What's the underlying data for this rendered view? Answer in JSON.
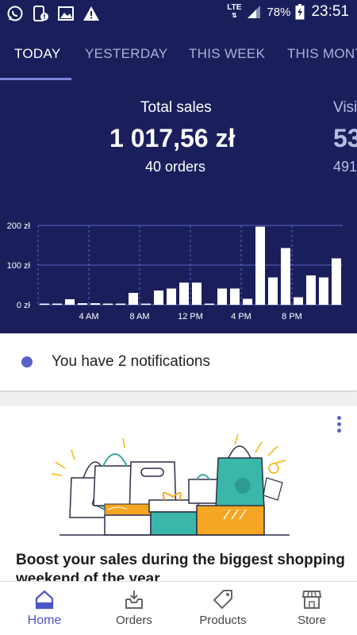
{
  "status_bar": {
    "network": "LTE",
    "battery_percent": "78%",
    "time": "23:51",
    "left_icons": [
      "whatsapp-icon",
      "phone-alert-icon",
      "gallery-icon",
      "warning-icon"
    ]
  },
  "tabs": [
    {
      "label": "TODAY",
      "active": true
    },
    {
      "label": "YESTERDAY",
      "active": false
    },
    {
      "label": "THIS WEEK",
      "active": false
    },
    {
      "label": "THIS MONT",
      "active": false
    }
  ],
  "stats": {
    "sales": {
      "title": "Total sales",
      "value": "1 017,56 zł",
      "sub": "40 orders"
    },
    "visitors": {
      "title": "Visi",
      "value": "53",
      "sub": "491"
    }
  },
  "chart_data": {
    "type": "bar",
    "y_tick_labels": [
      "200 zł",
      "100 zł",
      "0 zł"
    ],
    "y_ticks": [
      200,
      100,
      0
    ],
    "ylim": [
      0,
      200
    ],
    "x_tick_labels": [
      "4 AM",
      "8 AM",
      "12 PM",
      "4 PM",
      "8 PM"
    ],
    "x_ticks_at_hour": [
      4,
      8,
      12,
      16,
      20
    ],
    "hours": [
      0,
      1,
      2,
      3,
      4,
      5,
      6,
      7,
      8,
      9,
      10,
      11,
      12,
      13,
      14,
      15,
      16,
      17,
      18,
      19,
      20,
      21,
      22,
      23
    ],
    "values": [
      3,
      3,
      14,
      4,
      4,
      3,
      3,
      30,
      3,
      36,
      41,
      56,
      56,
      3,
      41,
      41,
      15,
      197,
      69,
      143,
      19,
      74,
      69,
      117
    ],
    "bar_color": "#ffffff",
    "grid": true
  },
  "notification": {
    "text": "You have 2 notifications"
  },
  "promo_card": {
    "title": "Boost your sales during the biggest shopping weekend of the year",
    "menu_icon": "more-vertical-icon"
  },
  "bottom_nav": [
    {
      "label": "Home",
      "icon": "home-icon",
      "active": true
    },
    {
      "label": "Orders",
      "icon": "orders-inbox-icon",
      "active": false
    },
    {
      "label": "Products",
      "icon": "tag-icon",
      "active": false
    },
    {
      "label": "Store",
      "icon": "store-icon",
      "active": false
    }
  ],
  "colors": {
    "header_bg": "#1a1f5c",
    "accent": "#5a63c8",
    "nav_active": "#4b55c6"
  }
}
